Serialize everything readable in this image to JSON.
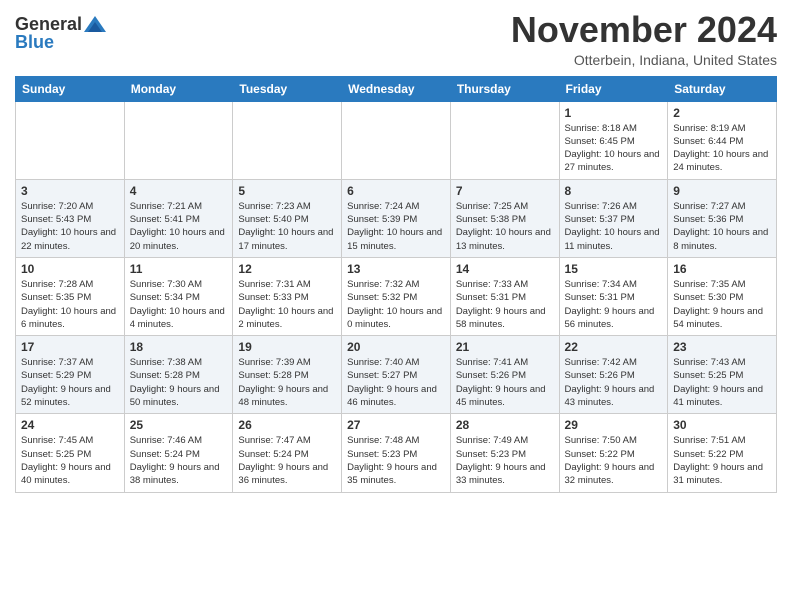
{
  "header": {
    "logo": {
      "line1": "General",
      "line2": "Blue"
    },
    "title": "November 2024",
    "location": "Otterbein, Indiana, United States"
  },
  "days_of_week": [
    "Sunday",
    "Monday",
    "Tuesday",
    "Wednesday",
    "Thursday",
    "Friday",
    "Saturday"
  ],
  "weeks": [
    [
      {
        "day": "",
        "info": ""
      },
      {
        "day": "",
        "info": ""
      },
      {
        "day": "",
        "info": ""
      },
      {
        "day": "",
        "info": ""
      },
      {
        "day": "",
        "info": ""
      },
      {
        "day": "1",
        "info": "Sunrise: 8:18 AM\nSunset: 6:45 PM\nDaylight: 10 hours and 27 minutes."
      },
      {
        "day": "2",
        "info": "Sunrise: 8:19 AM\nSunset: 6:44 PM\nDaylight: 10 hours and 24 minutes."
      }
    ],
    [
      {
        "day": "3",
        "info": "Sunrise: 7:20 AM\nSunset: 5:43 PM\nDaylight: 10 hours and 22 minutes."
      },
      {
        "day": "4",
        "info": "Sunrise: 7:21 AM\nSunset: 5:41 PM\nDaylight: 10 hours and 20 minutes."
      },
      {
        "day": "5",
        "info": "Sunrise: 7:23 AM\nSunset: 5:40 PM\nDaylight: 10 hours and 17 minutes."
      },
      {
        "day": "6",
        "info": "Sunrise: 7:24 AM\nSunset: 5:39 PM\nDaylight: 10 hours and 15 minutes."
      },
      {
        "day": "7",
        "info": "Sunrise: 7:25 AM\nSunset: 5:38 PM\nDaylight: 10 hours and 13 minutes."
      },
      {
        "day": "8",
        "info": "Sunrise: 7:26 AM\nSunset: 5:37 PM\nDaylight: 10 hours and 11 minutes."
      },
      {
        "day": "9",
        "info": "Sunrise: 7:27 AM\nSunset: 5:36 PM\nDaylight: 10 hours and 8 minutes."
      }
    ],
    [
      {
        "day": "10",
        "info": "Sunrise: 7:28 AM\nSunset: 5:35 PM\nDaylight: 10 hours and 6 minutes."
      },
      {
        "day": "11",
        "info": "Sunrise: 7:30 AM\nSunset: 5:34 PM\nDaylight: 10 hours and 4 minutes."
      },
      {
        "day": "12",
        "info": "Sunrise: 7:31 AM\nSunset: 5:33 PM\nDaylight: 10 hours and 2 minutes."
      },
      {
        "day": "13",
        "info": "Sunrise: 7:32 AM\nSunset: 5:32 PM\nDaylight: 10 hours and 0 minutes."
      },
      {
        "day": "14",
        "info": "Sunrise: 7:33 AM\nSunset: 5:31 PM\nDaylight: 9 hours and 58 minutes."
      },
      {
        "day": "15",
        "info": "Sunrise: 7:34 AM\nSunset: 5:31 PM\nDaylight: 9 hours and 56 minutes."
      },
      {
        "day": "16",
        "info": "Sunrise: 7:35 AM\nSunset: 5:30 PM\nDaylight: 9 hours and 54 minutes."
      }
    ],
    [
      {
        "day": "17",
        "info": "Sunrise: 7:37 AM\nSunset: 5:29 PM\nDaylight: 9 hours and 52 minutes."
      },
      {
        "day": "18",
        "info": "Sunrise: 7:38 AM\nSunset: 5:28 PM\nDaylight: 9 hours and 50 minutes."
      },
      {
        "day": "19",
        "info": "Sunrise: 7:39 AM\nSunset: 5:28 PM\nDaylight: 9 hours and 48 minutes."
      },
      {
        "day": "20",
        "info": "Sunrise: 7:40 AM\nSunset: 5:27 PM\nDaylight: 9 hours and 46 minutes."
      },
      {
        "day": "21",
        "info": "Sunrise: 7:41 AM\nSunset: 5:26 PM\nDaylight: 9 hours and 45 minutes."
      },
      {
        "day": "22",
        "info": "Sunrise: 7:42 AM\nSunset: 5:26 PM\nDaylight: 9 hours and 43 minutes."
      },
      {
        "day": "23",
        "info": "Sunrise: 7:43 AM\nSunset: 5:25 PM\nDaylight: 9 hours and 41 minutes."
      }
    ],
    [
      {
        "day": "24",
        "info": "Sunrise: 7:45 AM\nSunset: 5:25 PM\nDaylight: 9 hours and 40 minutes."
      },
      {
        "day": "25",
        "info": "Sunrise: 7:46 AM\nSunset: 5:24 PM\nDaylight: 9 hours and 38 minutes."
      },
      {
        "day": "26",
        "info": "Sunrise: 7:47 AM\nSunset: 5:24 PM\nDaylight: 9 hours and 36 minutes."
      },
      {
        "day": "27",
        "info": "Sunrise: 7:48 AM\nSunset: 5:23 PM\nDaylight: 9 hours and 35 minutes."
      },
      {
        "day": "28",
        "info": "Sunrise: 7:49 AM\nSunset: 5:23 PM\nDaylight: 9 hours and 33 minutes."
      },
      {
        "day": "29",
        "info": "Sunrise: 7:50 AM\nSunset: 5:22 PM\nDaylight: 9 hours and 32 minutes."
      },
      {
        "day": "30",
        "info": "Sunrise: 7:51 AM\nSunset: 5:22 PM\nDaylight: 9 hours and 31 minutes."
      }
    ]
  ]
}
